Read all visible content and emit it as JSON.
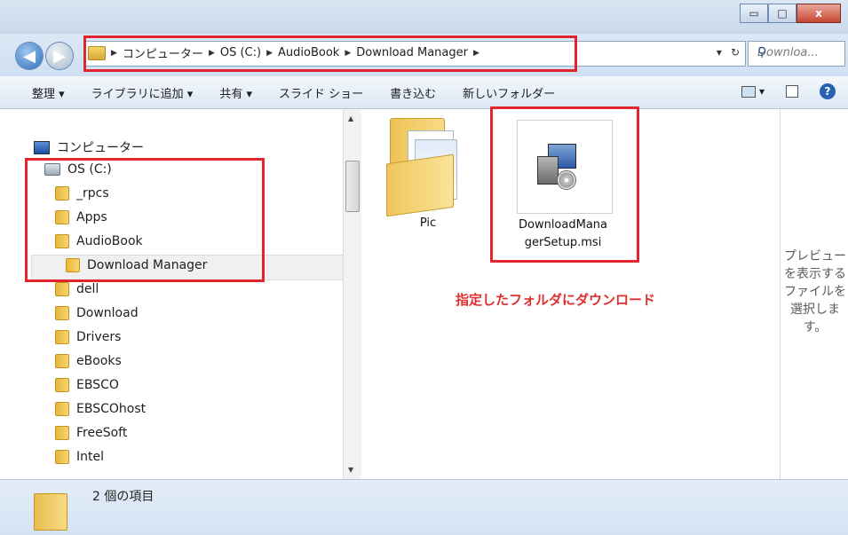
{
  "window": {
    "minimize_glyph": "▭",
    "maximize_glyph": "□",
    "close_glyph": "x"
  },
  "address_bar": {
    "breadcrumbs": [
      "コンピューター",
      "OS (C:)",
      "AudioBook",
      "Download Manager"
    ],
    "dropdown_glyph": "▾",
    "refresh_glyph": "↻"
  },
  "search": {
    "placeholder": "Downloa..."
  },
  "toolbar": {
    "organize": "整理 ▾",
    "add_to_library": "ライブラリに追加 ▾",
    "share": "共有 ▾",
    "slideshow": "スライド ショー",
    "burn": "書き込む",
    "new_folder": "新しいフォルダー",
    "help_glyph": "?"
  },
  "nav_tree": {
    "computer": "コンピューター",
    "drive": "OS (C:)",
    "folders": [
      "_rpcs",
      "Apps",
      "AudioBook",
      "Download Manager",
      "dell",
      "Download",
      "Drivers",
      "eBooks",
      "EBSCO",
      "EBSCOhost",
      "FreeSoft",
      "Intel"
    ]
  },
  "content": {
    "items": [
      {
        "name": "Pic"
      },
      {
        "name_line1": "DownloadMana",
        "name_line2": "gerSetup.msi"
      }
    ],
    "annotation": "指定したフォルダにダウンロード"
  },
  "preview": {
    "text_lines": [
      "プレビュー",
      "を表示する",
      "ファイルを",
      "選択しま",
      "す。"
    ]
  },
  "status": {
    "count_text": "2 個の項目"
  },
  "colors": {
    "highlight": "#e1252f",
    "annotation": "#e02f2f"
  }
}
